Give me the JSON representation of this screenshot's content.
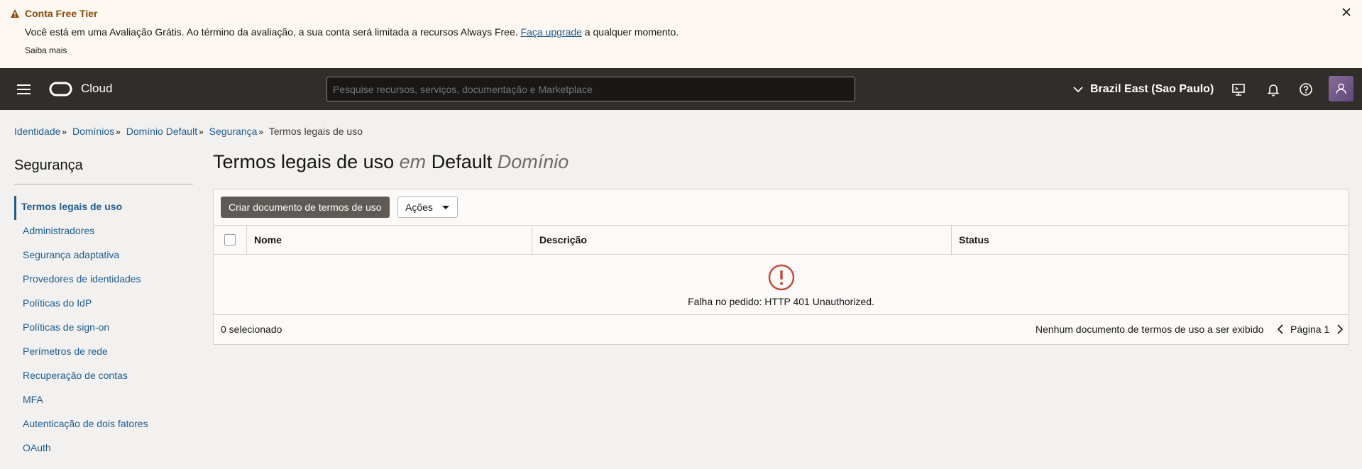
{
  "banner": {
    "title": "Conta Free Tier",
    "text_before": "Você está em uma Avaliação Grátis. Ao término da avaliação, a sua conta será limitada a recursos Always Free.",
    "link": "Faça upgrade",
    "text_after": "a qualquer momento.",
    "more": "Saiba mais",
    "warning_color": "#8a4a0a"
  },
  "header": {
    "app_name": "Cloud",
    "search_placeholder": "Pesquise recursos, serviços, documentação e Marketplace",
    "region": "Brazil East (Sao Paulo)",
    "icons": [
      "menu-icon",
      "cloud-shell-icon",
      "bell-icon",
      "help-icon",
      "user-icon"
    ]
  },
  "breadcrumb": [
    {
      "label": "Identidade"
    },
    {
      "label": "Domínios"
    },
    {
      "label": "Domínio Default"
    },
    {
      "label": "Segurança"
    },
    {
      "label": "Termos legais de uso"
    }
  ],
  "sidebar": {
    "title": "Segurança",
    "items": [
      {
        "label": "Termos legais de uso",
        "active": true
      },
      {
        "label": "Administradores"
      },
      {
        "label": "Segurança adaptativa"
      },
      {
        "label": "Provedores de identidades"
      },
      {
        "label": "Políticas do IdP"
      },
      {
        "label": "Políticas de sign-on"
      },
      {
        "label": "Perímetros de rede"
      },
      {
        "label": "Recuperação de contas"
      },
      {
        "label": "MFA"
      },
      {
        "label": "Autenticação de dois fatores"
      },
      {
        "label": "OAuth"
      }
    ]
  },
  "main": {
    "title_main": "Termos legais de uso",
    "title_em": "em",
    "title_domain": "Default",
    "title_domain_label": "Domínio",
    "create_button": "Criar documento de termos de uso",
    "actions_button": "Ações",
    "columns": [
      "Nome",
      "Descrição",
      "Status"
    ],
    "error_message": "Falha no pedido: HTTP 401 Unauthorized.",
    "selected_count": "0 selecionado",
    "empty_message": "Nenhum documento de termos de uso a ser exibido",
    "page_label": "Página 1",
    "error_color": "#c74634"
  }
}
